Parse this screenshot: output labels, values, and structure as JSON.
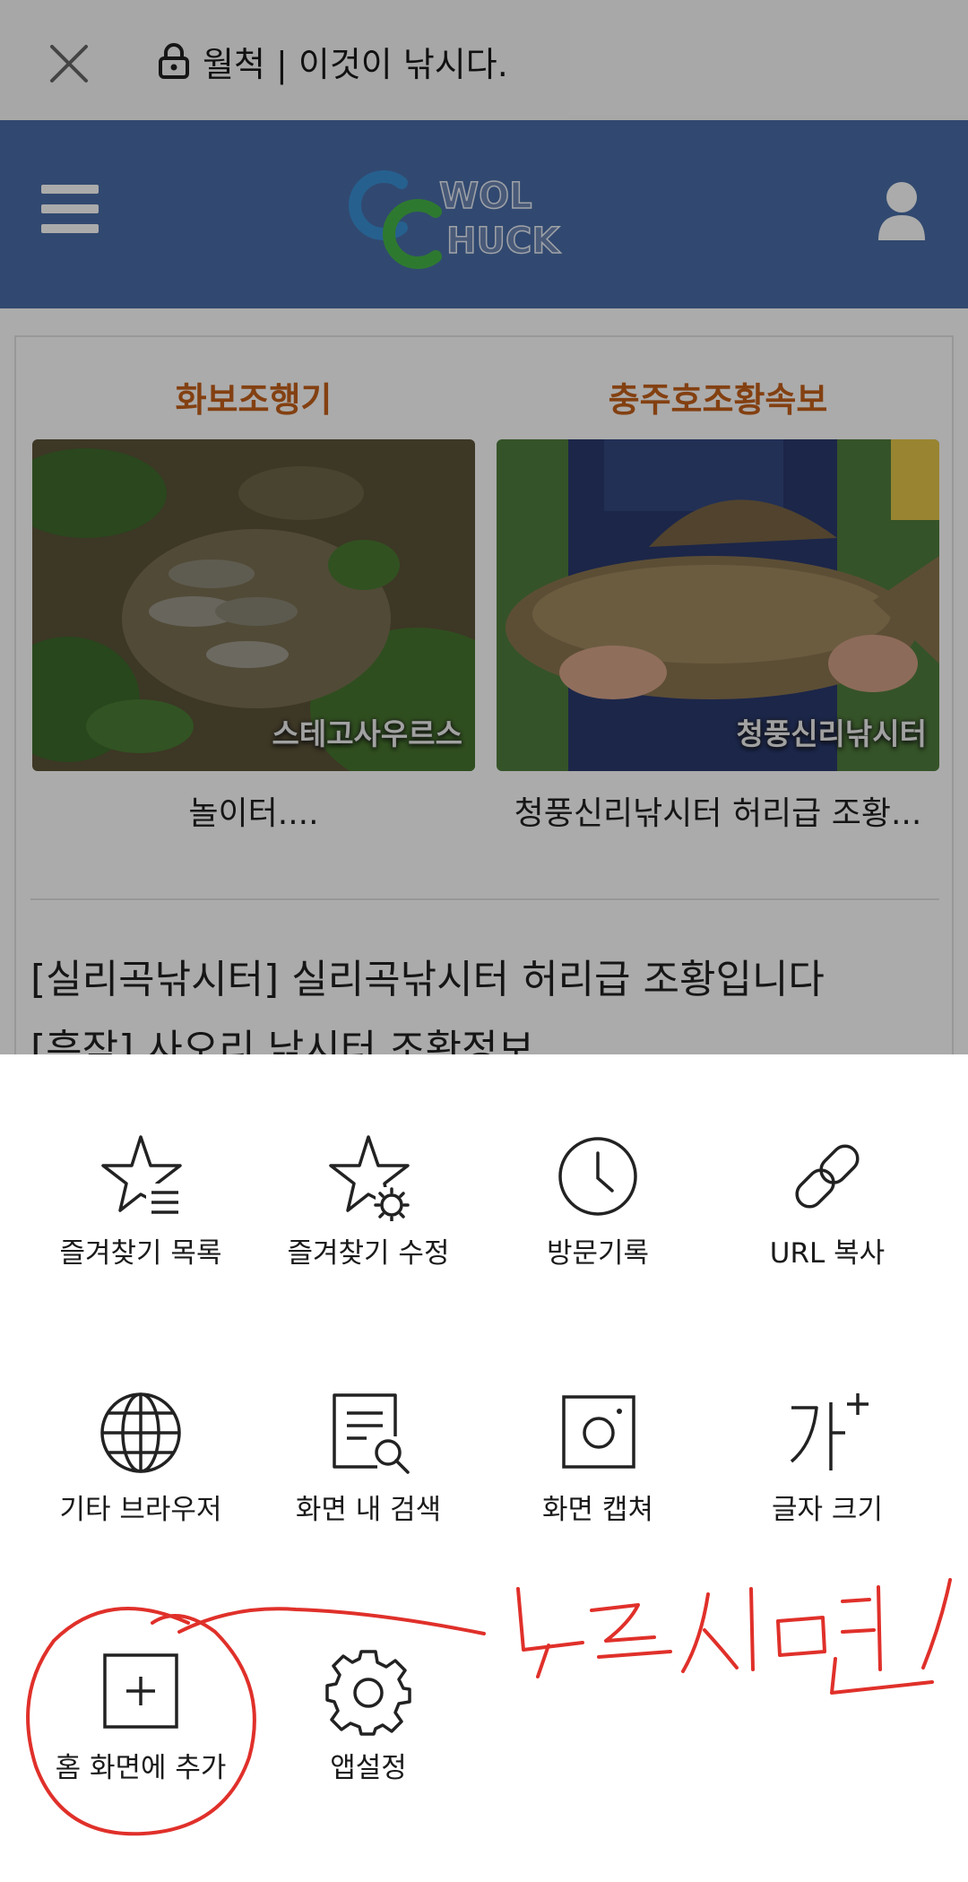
{
  "browser": {
    "url_title": "월척 | 이것이 낚시다."
  },
  "site": {
    "logo_line1": "WOL",
    "logo_line2": "HUCK"
  },
  "cards": [
    {
      "title": "화보조행기",
      "photo_tag": "스테고사우르스",
      "caption": "놀이터...."
    },
    {
      "title": "충주호조황속보",
      "photo_tag": "청풍신리낚시터",
      "caption": "청풍신리낚시터 허리급 조황..."
    }
  ],
  "posts": [
    {
      "category": "[실리곡낚시터]",
      "title": "실리곡낚시터 허리급 조황입니다"
    },
    {
      "category": "[흑작]",
      "title": "사오리 낚시터 조황정보"
    }
  ],
  "menu": {
    "items": [
      {
        "label": "즐겨찾기 목록",
        "icon": "star-list-icon"
      },
      {
        "label": "즐겨찾기 수정",
        "icon": "star-gear-icon"
      },
      {
        "label": "방문기록",
        "icon": "clock-icon"
      },
      {
        "label": "URL 복사",
        "icon": "link-icon"
      },
      {
        "label": "기타 브라우저",
        "icon": "globe-icon"
      },
      {
        "label": "화면 내 검색",
        "icon": "document-search-icon"
      },
      {
        "label": "화면 캡쳐",
        "icon": "camera-icon"
      },
      {
        "label": "글자 크기",
        "icon": "font-size-icon"
      },
      {
        "label": "홈 화면에 추가",
        "icon": "plus-square-icon"
      },
      {
        "label": "앱설정",
        "icon": "gear-icon"
      }
    ]
  },
  "annotation": {
    "handwritten_text": "누르시면",
    "color": "#e0302a"
  },
  "colors": {
    "header_bg": "#4a6ea8",
    "card_title": "#c4601a",
    "sheet_bg": "#ffffff"
  }
}
